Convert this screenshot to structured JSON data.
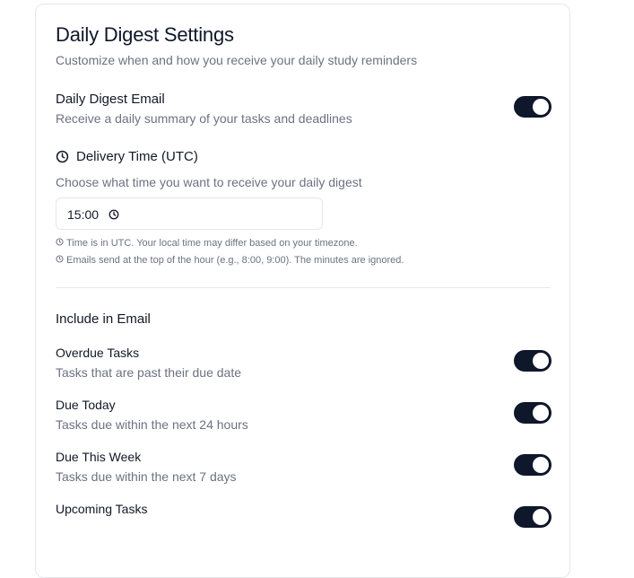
{
  "header": {
    "title": "Daily Digest Settings",
    "subtitle": "Customize when and how you receive your daily study reminders"
  },
  "digest_email": {
    "label": "Daily Digest Email",
    "description": "Receive a daily summary of your tasks and deadlines",
    "enabled": true
  },
  "delivery": {
    "icon": "clock-icon",
    "label": "Delivery Time (UTC)",
    "description": "Choose what time you want to receive your daily digest",
    "time_value": "15:00",
    "hints": [
      "Time is in UTC. Your local time may differ based on your timezone.",
      "Emails send at the top of the hour (e.g., 8:00, 9:00). The minutes are ignored."
    ]
  },
  "include": {
    "title": "Include in Email",
    "items": [
      {
        "label": "Overdue Tasks",
        "description": "Tasks that are past their due date",
        "enabled": true
      },
      {
        "label": "Due Today",
        "description": "Tasks due within the next 24 hours",
        "enabled": true
      },
      {
        "label": "Due This Week",
        "description": "Tasks due within the next 7 days",
        "enabled": true
      },
      {
        "label": "Upcoming Tasks",
        "description": "",
        "enabled": true
      }
    ]
  },
  "colors": {
    "toggle_on": "#0f172a",
    "muted_text": "#6b7280",
    "border": "#e5e7eb"
  }
}
